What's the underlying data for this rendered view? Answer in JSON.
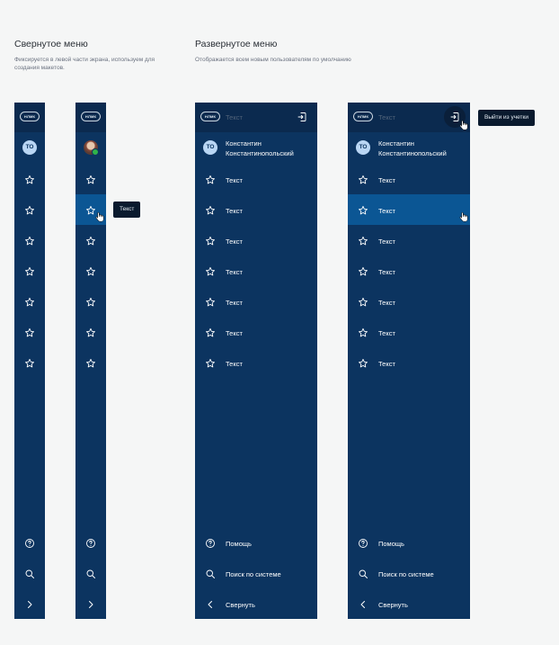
{
  "sections": {
    "collapsed": {
      "title": "Свернутое меню",
      "description": "Фиксируется в левой части экрана, используем для создания макетов."
    },
    "expanded": {
      "title": "Развернутое меню",
      "description": "Отображается всем новым пользователям по умолчанию"
    }
  },
  "logo_text": "НЛМК",
  "user": {
    "initials": "ТО",
    "name_first": "Константин",
    "name_last": "Константинопольский"
  },
  "search": {
    "placeholder": "Текст"
  },
  "menu_items": [
    "Текст",
    "Текст",
    "Текст",
    "Текст",
    "Текст",
    "Текст",
    "Текст"
  ],
  "tooltip_item": "Текст",
  "tooltip_logout": "Выйти из учетки",
  "footer": {
    "help": "Помощь",
    "search": "Поиск по системе",
    "collapse": "Свернуть"
  },
  "icons": {
    "menu_item": "star-icon",
    "help": "help-circle-icon",
    "search": "search-icon",
    "expand": "chevron-right-icon",
    "collapse": "chevron-left-icon",
    "logout": "logout-icon",
    "cursor": "hand-cursor-icon"
  },
  "colors": {
    "background": "#f5f6f6",
    "panel": "#0c3460",
    "header": "#0b2a4f",
    "active_item": "#0b5694",
    "avatar": "#b9d6f4",
    "tooltip": "#0a1a2e",
    "online": "#2fb34a"
  }
}
